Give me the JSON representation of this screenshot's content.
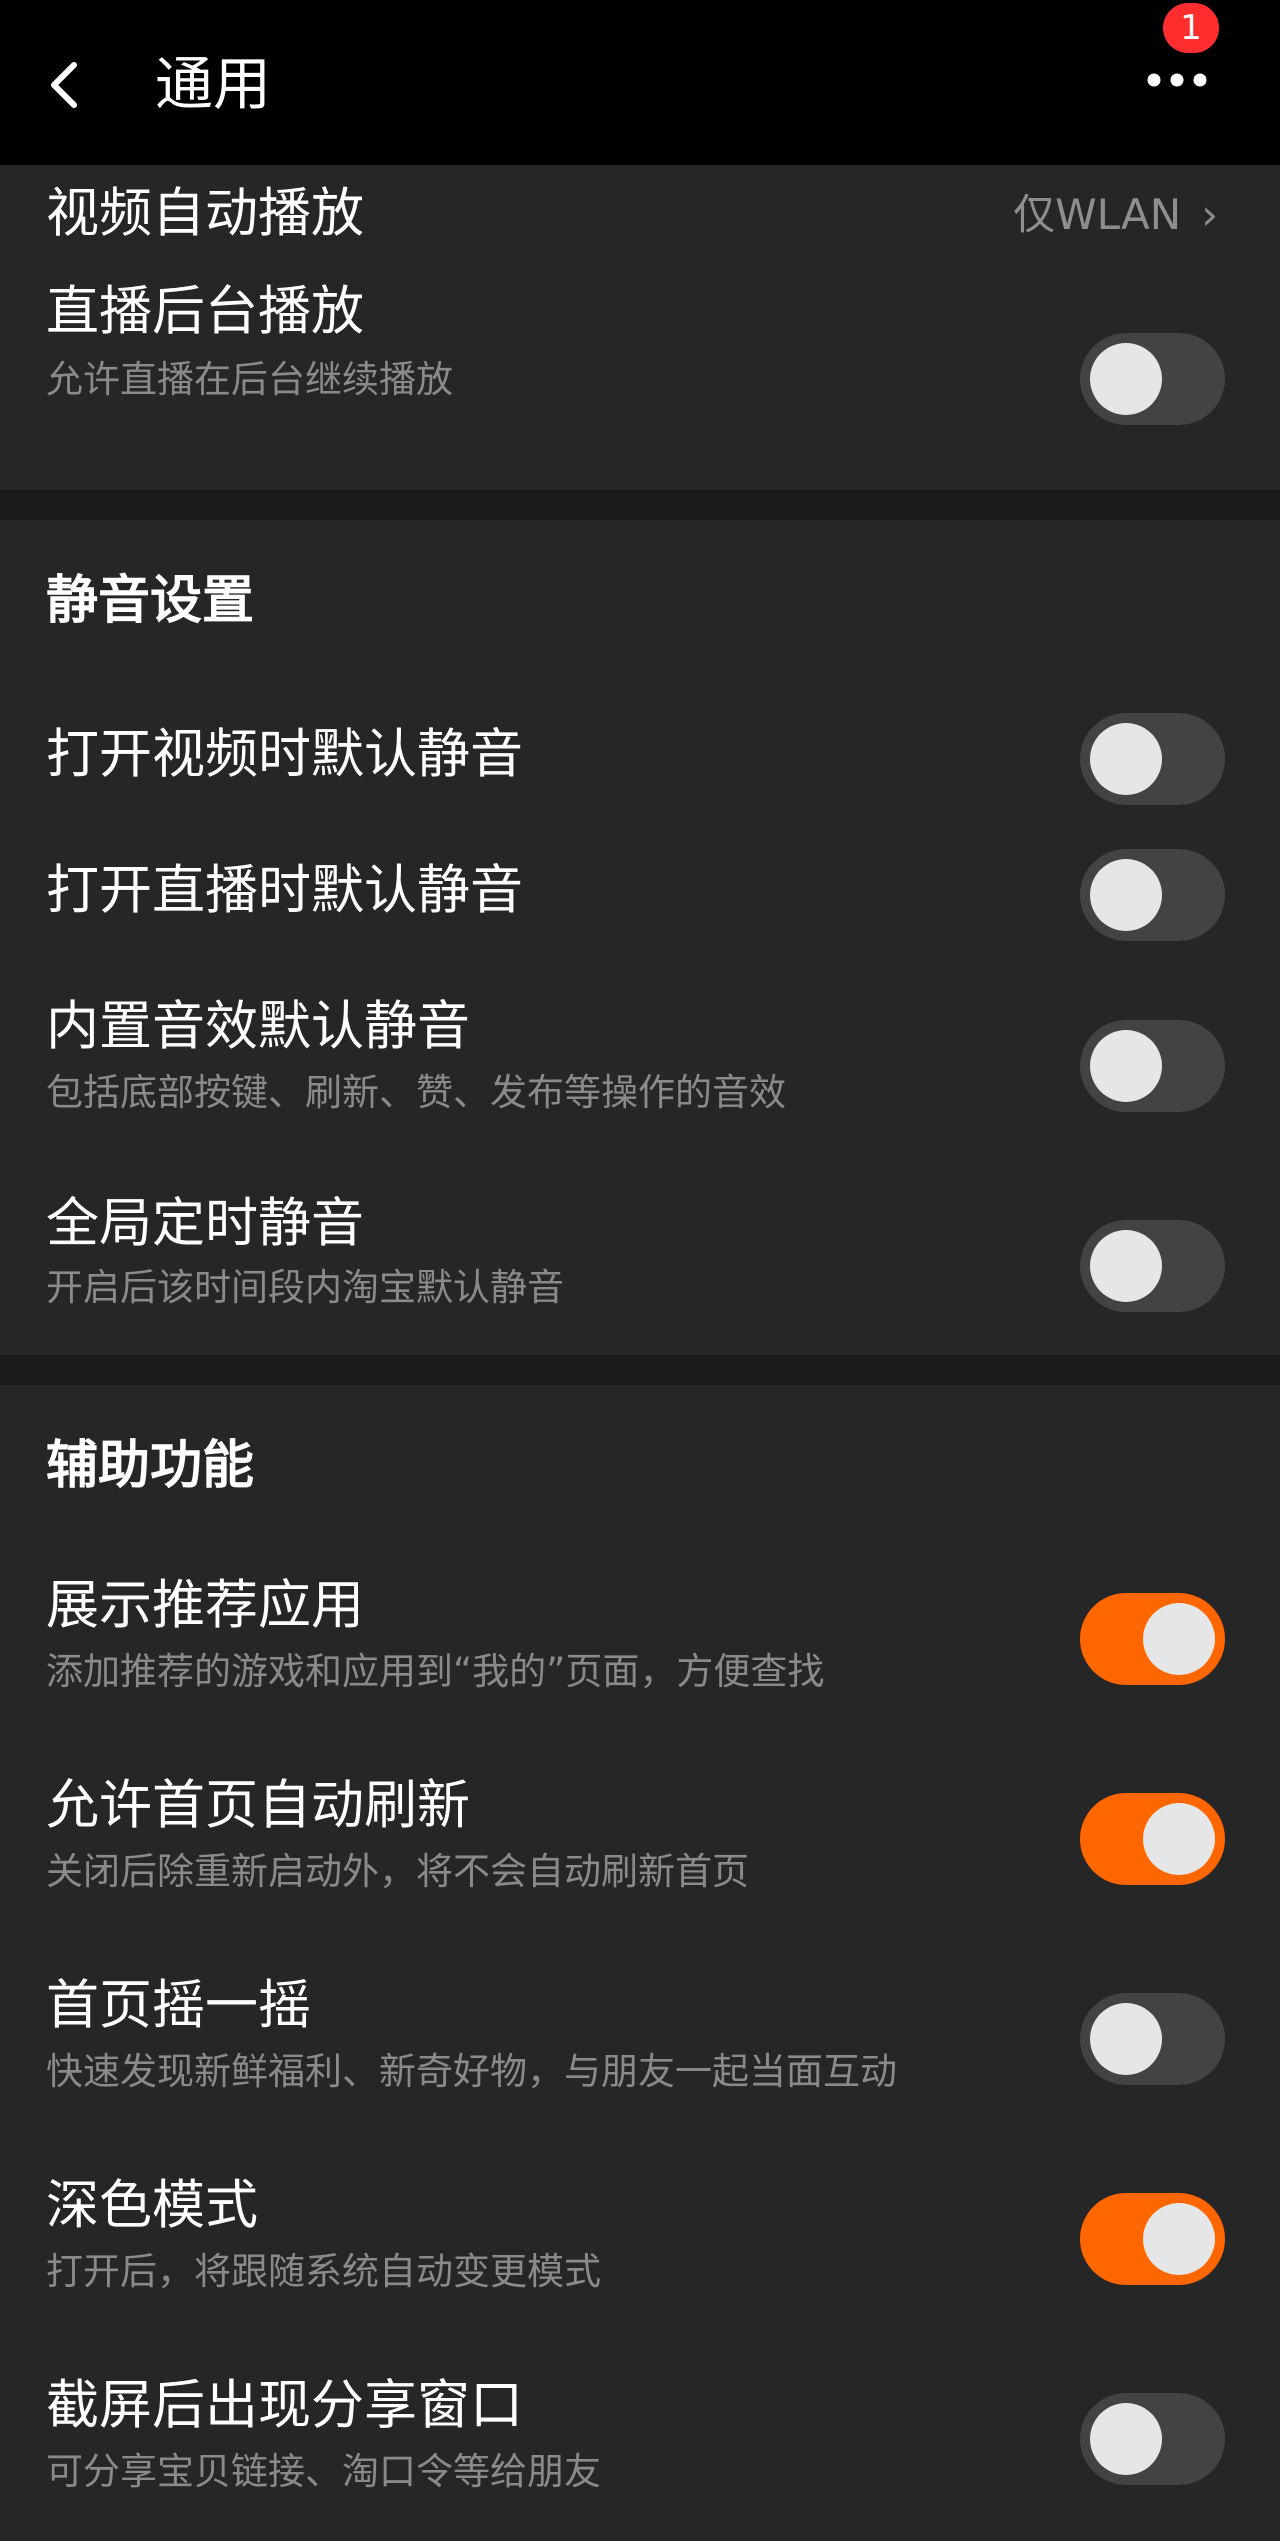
{
  "header": {
    "title": "通用",
    "notification_count": "1"
  },
  "playback": {
    "video_autoplay": {
      "title": "视频自动播放",
      "value": "仅WLAN",
      "chevron": "›"
    },
    "live_background": {
      "title": "直播后台播放",
      "desc": "允许直播在后台继续播放",
      "enabled": false
    }
  },
  "mute_section": {
    "title": "静音设置",
    "items": [
      {
        "title": "打开视频时默认静音",
        "desc": "",
        "enabled": false
      },
      {
        "title": "打开直播时默认静音",
        "desc": "",
        "enabled": false
      },
      {
        "title": "内置音效默认静音",
        "desc": "包括底部按键、刷新、赞、发布等操作的音效",
        "enabled": false
      },
      {
        "title": "全局定时静音",
        "desc": "开启后该时间段内淘宝默认静音",
        "enabled": false
      }
    ]
  },
  "assist_section": {
    "title": "辅助功能",
    "items": [
      {
        "title": "展示推荐应用",
        "desc": "添加推荐的游戏和应用到“我的”页面，方便查找",
        "enabled": true
      },
      {
        "title": "允许首页自动刷新",
        "desc": "关闭后除重新启动外，将不会自动刷新首页",
        "enabled": true
      },
      {
        "title": "首页摇一摇",
        "desc": "快速发现新鲜福利、新奇好物，与朋友一起当面互动",
        "enabled": false
      },
      {
        "title": "深色模式",
        "desc": "打开后，将跟随系统自动变更模式",
        "enabled": true
      },
      {
        "title": "截屏后出现分享窗口",
        "desc": "可分享宝贝链接、淘口令等给朋友",
        "enabled": false
      }
    ]
  },
  "colors": {
    "accent": "#ff6600",
    "toggle_off": "#434343",
    "badge": "#ff2d2d",
    "background": "#262626"
  }
}
